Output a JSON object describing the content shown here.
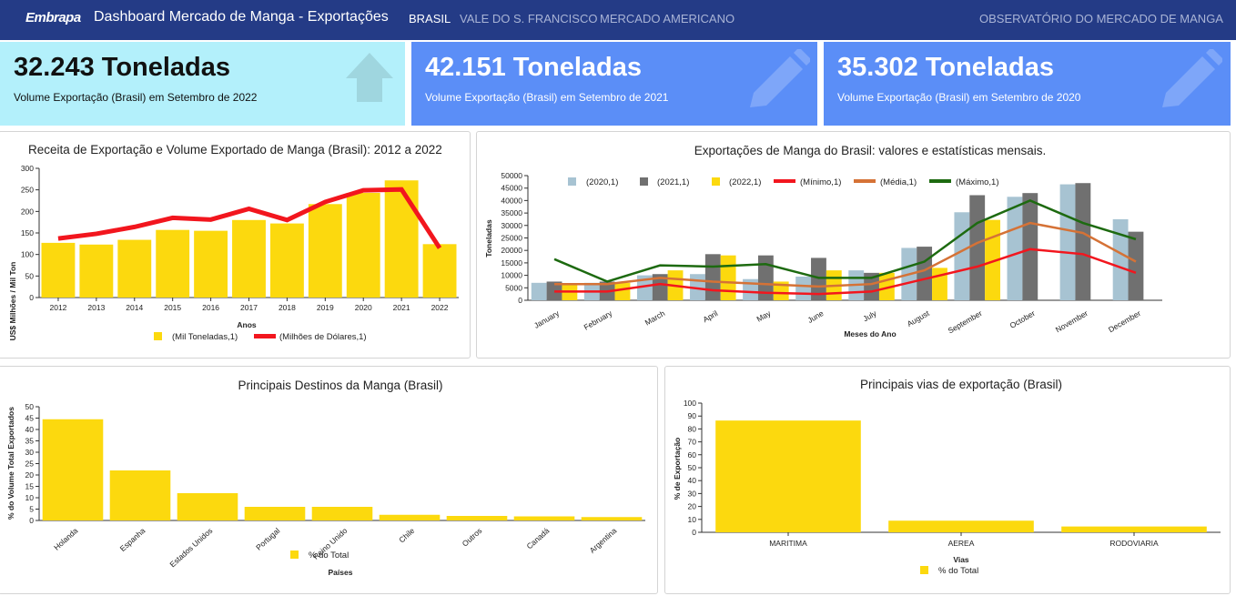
{
  "nav": {
    "logo": "Embrapa",
    "title": "Dashboard Mercado de Manga - Exportações",
    "links": [
      "BRASIL",
      "VALE DO S. FRANCISCO",
      "MERCADO AMERICANO"
    ],
    "right_link": "OBSERVATÓRIO DO MERCADO DE MANGA"
  },
  "cards": [
    {
      "value": "32.243 Toneladas",
      "caption": "Volume Exportação (Brasil) em Setembro de 2022",
      "icon": "arrow-up-icon",
      "bg": "#b3f0fb"
    },
    {
      "value": "42.151 Toneladas",
      "caption": "Volume Exportação (Brasil) em Setembro de 2021",
      "icon": "pencil-icon",
      "bg": "#5b8ef7"
    },
    {
      "value": "35.302 Toneladas",
      "caption": "Volume Exportação (Brasil) em Setembro de 2020",
      "icon": "pencil-icon",
      "bg": "#5b8ef7"
    }
  ],
  "colors": {
    "yellow": "#fcd90e",
    "red": "#f2161e",
    "gray": "#707070",
    "lightblue": "#a7c3d2",
    "orange": "#d57236",
    "green": "#1d6a10",
    "accent": "#243b86"
  },
  "chart_data": [
    {
      "type": "bar",
      "title": "Receita de Exportação e Volume Exportado de Manga (Brasil): 2012 a 2022",
      "xlabel": "Anos",
      "ylabel": "US$ Milhões / Mil Ton",
      "ylim": [
        0,
        300
      ],
      "yticks": [
        0,
        50,
        100,
        150,
        200,
        250,
        300
      ],
      "categories": [
        "2012",
        "2013",
        "2014",
        "2015",
        "2016",
        "2017",
        "2018",
        "2019",
        "2020",
        "2021",
        "2022"
      ],
      "series": [
        {
          "name": "(Mil Toneladas,1)",
          "type": "bar",
          "values": [
            127,
            123,
            134,
            157,
            155,
            180,
            172,
            217,
            243,
            272,
            124
          ]
        },
        {
          "name": "(Milhões de Dólares,1)",
          "type": "line",
          "values": [
            137,
            148,
            164,
            185,
            181,
            206,
            180,
            222,
            249,
            251,
            115
          ]
        }
      ],
      "legend": "bottom"
    },
    {
      "type": "bar",
      "title": "Exportações de Manga do Brasil: valores e estatísticas mensais.",
      "xlabel": "Meses do Ano",
      "ylabel": "Toneladas",
      "ylim": [
        0,
        50000
      ],
      "yticks": [
        0,
        5000,
        10000,
        15000,
        20000,
        25000,
        30000,
        35000,
        40000,
        45000,
        50000
      ],
      "categories": [
        "January",
        "February",
        "March",
        "April",
        "May",
        "June",
        "July",
        "August",
        "September",
        "October",
        "November",
        "December"
      ],
      "series": [
        {
          "name": "(2020,1)",
          "type": "bar",
          "values": [
            7000,
            7000,
            10000,
            10500,
            8500,
            9500,
            12000,
            21000,
            35302,
            41500,
            46500,
            32500
          ]
        },
        {
          "name": "(2021,1)",
          "type": "bar",
          "values": [
            7500,
            7500,
            10500,
            18500,
            18000,
            17000,
            11000,
            21500,
            42151,
            43000,
            47000,
            27500
          ]
        },
        {
          "name": "(2022,1)",
          "type": "bar",
          "values": [
            6500,
            7000,
            12000,
            18000,
            7500,
            12000,
            11000,
            13000,
            32243,
            null,
            null,
            null
          ]
        },
        {
          "name": "(Mínimo,1)",
          "type": "line",
          "values": [
            3500,
            3500,
            6500,
            4000,
            3000,
            2500,
            3500,
            8500,
            13500,
            20500,
            18500,
            11000
          ]
        },
        {
          "name": "(Média,1)",
          "type": "line",
          "values": [
            6500,
            6500,
            9000,
            7500,
            6500,
            5500,
            6500,
            12000,
            23000,
            31000,
            27000,
            15500
          ]
        },
        {
          "name": "(Máximo,1)",
          "type": "line",
          "values": [
            16500,
            7500,
            14000,
            13500,
            14500,
            9000,
            9000,
            15500,
            31000,
            40000,
            31000,
            24500
          ]
        }
      ],
      "legend": "top"
    },
    {
      "type": "bar",
      "title": "Principais Destinos da Manga (Brasil)",
      "xlabel": "Países",
      "ylabel": "% do Volume Total Exportados",
      "ylim": [
        0,
        50
      ],
      "yticks": [
        0,
        5,
        10,
        15,
        20,
        25,
        30,
        35,
        40,
        45,
        50
      ],
      "categories": [
        "Holanda",
        "Espanha",
        "Estados Unidos",
        "Portugal",
        "Reino Unido",
        "Chile",
        "Outros",
        "Canadá",
        "Argentina"
      ],
      "series": [
        {
          "name": "% do Total",
          "values": [
            44.5,
            22,
            12,
            6,
            6,
            2.5,
            2,
            1.8,
            1.5
          ]
        }
      ],
      "legend": "bottom"
    },
    {
      "type": "bar",
      "title": "Principais vias de exportação (Brasil)",
      "xlabel": "Vias",
      "ylabel": "% de Exportação",
      "ylim": [
        0,
        100
      ],
      "yticks": [
        0,
        10,
        20,
        30,
        40,
        50,
        60,
        70,
        80,
        90,
        100
      ],
      "categories": [
        "MARITIMA",
        "AEREA",
        "RODOVIARIA"
      ],
      "series": [
        {
          "name": "% do Total",
          "values": [
            86.5,
            9,
            4.5
          ]
        }
      ],
      "legend": "bottom"
    }
  ]
}
